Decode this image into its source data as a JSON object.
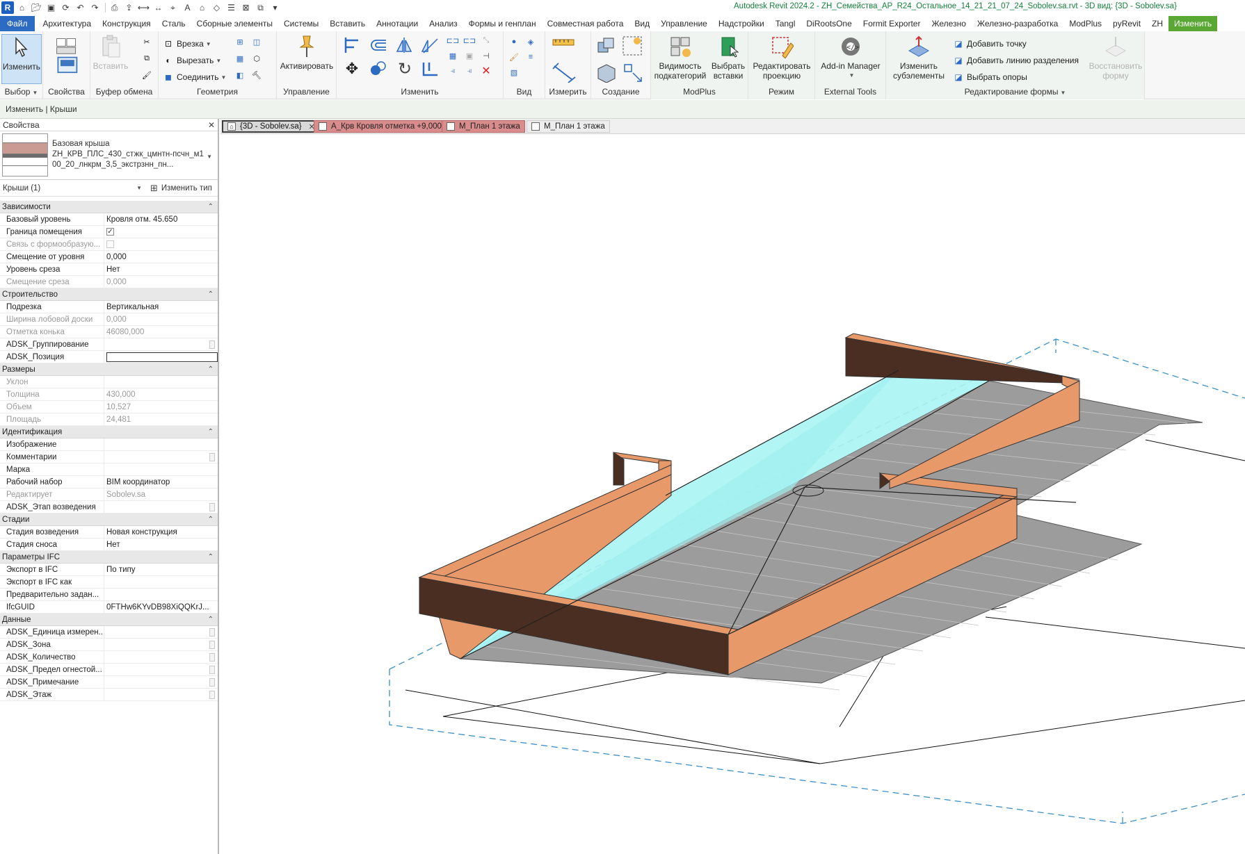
{
  "window_title": "Autodesk Revit 2024.2 - ZH_Семейства_АР_R24_Остальное_14_21_21_07_24_Sobolev.sa.rvt - 3D вид: {3D - Sobolev.sa}",
  "app_icon_letter": "R",
  "menu_tabs": [
    "Файл",
    "Архитектура",
    "Конструкция",
    "Сталь",
    "Сборные элементы",
    "Системы",
    "Вставить",
    "Аннотации",
    "Анализ",
    "Формы и генплан",
    "Совместная работа",
    "Вид",
    "Управление",
    "Надстройки",
    "Tangl",
    "DiRootsOne",
    "Formit Exporter",
    "Железно",
    "Железно-разработка",
    "ModPlus",
    "pyRevit",
    "ZH",
    "Изменить"
  ],
  "ribbon": {
    "select_panel": {
      "title": "Выбор",
      "modify_label": "Изменить"
    },
    "properties_panel": {
      "label": "Свойства"
    },
    "clipboard_panel": {
      "title": "Буфер обмена",
      "paste_label": "Вставить"
    },
    "geometry_panel": {
      "title": "Геометрия",
      "cope_label": "Врезка",
      "cut_label": "Вырезать",
      "join_label": "Соединить"
    },
    "control_panel": {
      "title": "Управление",
      "activate_label": "Активировать"
    },
    "modify_panel": {
      "title": "Изменить"
    },
    "view_panel": {
      "title": "Вид"
    },
    "measure_panel": {
      "title": "Измерить"
    },
    "create_panel": {
      "title": "Создание"
    },
    "modplus_panel": {
      "title": "ModPlus",
      "subcat_label": "Видимость подкатегорий",
      "insert_label": "Выбрать вставки"
    },
    "mode_panel": {
      "title": "Режим",
      "edit_label": "Редактировать проекцию"
    },
    "external_panel": {
      "title": "External Tools",
      "addin_label": "Add-in Manager"
    },
    "shape_panel": {
      "title": "Редактирование формы",
      "subelem_label": "Изменить субэлементы",
      "add_point": "Добавить точку",
      "add_split": "Добавить линию разделения",
      "pick_supports": "Выбрать опоры",
      "reset_label": "Восстановить форму"
    }
  },
  "context_bar": "Изменить | Крыши",
  "properties": {
    "title": "Свойства",
    "type_family": "Базовая крыша",
    "type_name": "ZH_КРВ_ПЛС_430_стжк_цмнтн-псчн_м100_20_лнкрм_3,5_экстрзнн_пн...",
    "filter": "Крыши (1)",
    "edit_type": "Изменить тип",
    "groups": [
      {
        "name": "Зависимости",
        "rows": [
          {
            "n": "Базовый уровень",
            "v": "Кровля отм. 45.650"
          },
          {
            "n": "Граница помещения",
            "v": "",
            "check": true
          },
          {
            "n": "Связь с формообразую...",
            "v": "",
            "check": false,
            "dim": true
          },
          {
            "n": "Смещение от уровня",
            "v": "0,000"
          },
          {
            "n": "Уровень среза",
            "v": "Нет"
          },
          {
            "n": "Смещение среза",
            "v": "0,000",
            "dim": true
          }
        ]
      },
      {
        "name": "Строительство",
        "rows": [
          {
            "n": "Подрезка",
            "v": "Вертикальная"
          },
          {
            "n": "Ширина лобовой доски",
            "v": "0,000",
            "dim": true
          },
          {
            "n": "Отметка конька",
            "v": "46080,000",
            "dim": true
          },
          {
            "n": "ADSK_Группирование",
            "v": "",
            "box": true
          },
          {
            "n": "ADSK_Позиция",
            "v": "",
            "field": true
          }
        ]
      },
      {
        "name": "Размеры",
        "rows": [
          {
            "n": "Уклон",
            "v": "",
            "dim": true
          },
          {
            "n": "Толщина",
            "v": "430,000",
            "dim": true
          },
          {
            "n": "Объем",
            "v": "10,527",
            "dim": true
          },
          {
            "n": "Площадь",
            "v": "24,481",
            "dim": true
          }
        ]
      },
      {
        "name": "Идентификация",
        "rows": [
          {
            "n": "Изображение",
            "v": ""
          },
          {
            "n": "Комментарии",
            "v": "",
            "box": true
          },
          {
            "n": "Марка",
            "v": ""
          },
          {
            "n": "Рабочий набор",
            "v": "BIM координатор"
          },
          {
            "n": "Редактирует",
            "v": "Sobolev.sa",
            "dim": true
          },
          {
            "n": "ADSK_Этап возведения",
            "v": "",
            "box": true
          }
        ]
      },
      {
        "name": "Стадии",
        "rows": [
          {
            "n": "Стадия возведения",
            "v": "Новая конструкция"
          },
          {
            "n": "Стадия сноса",
            "v": "Нет"
          }
        ]
      },
      {
        "name": "Параметры IFC",
        "rows": [
          {
            "n": "Экспорт в IFC",
            "v": "По типу"
          },
          {
            "n": "Экспорт в IFC как",
            "v": ""
          },
          {
            "n": "Предварительно задан...",
            "v": ""
          },
          {
            "n": "IfcGUID",
            "v": "0FTHw6KYvDB98XiQQKrJ..."
          }
        ]
      },
      {
        "name": "Данные",
        "rows": [
          {
            "n": "ADSK_Единица измерен...",
            "v": "",
            "box": true
          },
          {
            "n": "ADSK_Зона",
            "v": "",
            "box": true
          },
          {
            "n": "ADSK_Количество",
            "v": "",
            "box": true
          },
          {
            "n": "ADSK_Предел огнестой...",
            "v": "",
            "box": true
          },
          {
            "n": "ADSK_Примечание",
            "v": "",
            "box": true
          },
          {
            "n": "ADSK_Этаж",
            "v": "",
            "box": true
          }
        ]
      }
    ]
  },
  "view_tabs": [
    {
      "label": "{3D - Sobolev.sa}",
      "active": true
    },
    {
      "label": "А_Крв Кровля отметка +9,000",
      "active": false
    },
    {
      "label": "М_План 1 этажа",
      "active": false
    },
    {
      "label": "М_План 1 этажа",
      "active": false
    }
  ],
  "colors": {
    "file_tab": "#2d6bc2",
    "modify_tab": "#5aa834",
    "title_text": "#15803d",
    "wall_side_light": "#e8996a",
    "wall_side_dark": "#4a2e22",
    "roof_surface": "#9a9a9a",
    "selection_highlight": "#a8f4f4",
    "section_box": "#3a90c8"
  }
}
